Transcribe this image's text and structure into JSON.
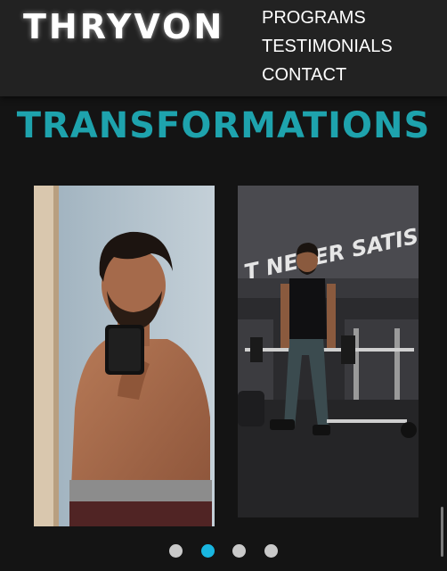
{
  "header": {
    "logo_text": "THRYVON",
    "nav": [
      {
        "label": "PROGRAMS"
      },
      {
        "label": "TESTIMONIALS"
      },
      {
        "label": "CONTACT"
      }
    ]
  },
  "transformations": {
    "title": "TRANSFORMATIONS",
    "after_photo_wall_text": "T NEVER SATIS",
    "carousel": {
      "slide_count": 4,
      "active_index": 1
    }
  },
  "colors": {
    "accent": "#1ea3ad",
    "active_dot": "#19b6e0",
    "inactive_dot": "#c9c9c9",
    "background": "#141414",
    "header": "#222222"
  }
}
